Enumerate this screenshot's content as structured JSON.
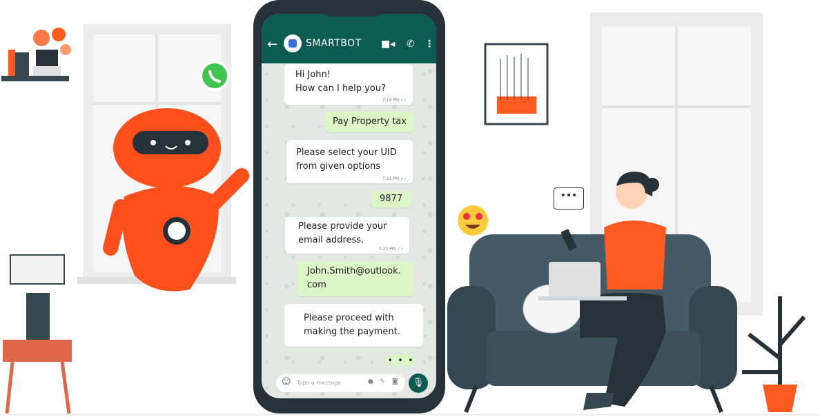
{
  "chat": {
    "contact_name": "SMARTBOT",
    "messages": [
      {
        "direction": "in",
        "text_lines": [
          "Hi John!",
          "How can I help you?"
        ],
        "time": "7:19 PM"
      },
      {
        "direction": "out",
        "text_lines": [
          "Pay Property tax"
        ]
      },
      {
        "direction": "in",
        "text_lines": [
          "Please select your UID",
          "from given options"
        ],
        "time": "7:21 PM"
      },
      {
        "direction": "out",
        "text_lines": [
          "9877"
        ]
      },
      {
        "direction": "in",
        "text_lines": [
          "Please provide your",
          "email address."
        ],
        "time": "7:23 PM"
      },
      {
        "direction": "out",
        "text_lines": [
          "John.Smith@outlook.",
          "com"
        ]
      },
      {
        "direction": "in",
        "text_lines": [
          "Please proceed with",
          "making the payment."
        ]
      }
    ],
    "typing_indicator": "• • •",
    "input_placeholder": "Type a message"
  },
  "icons": {
    "back": "arrow-left-icon",
    "video": "video-camera-icon",
    "call": "phone-icon",
    "menu": "more-vertical-icon",
    "emoji": "emoji-icon",
    "attach": "paperclip-icon",
    "camera": "camera-icon",
    "mic": "microphone-icon",
    "whatsapp": "whatsapp-logo"
  },
  "speech_bubble": "•••",
  "colors": {
    "header": "#0b5c50",
    "outgoing": "#dcf5c6",
    "robot": "#ff4f1a",
    "woman_shirt": "#ff5a1f",
    "sofa": "#455a64"
  }
}
